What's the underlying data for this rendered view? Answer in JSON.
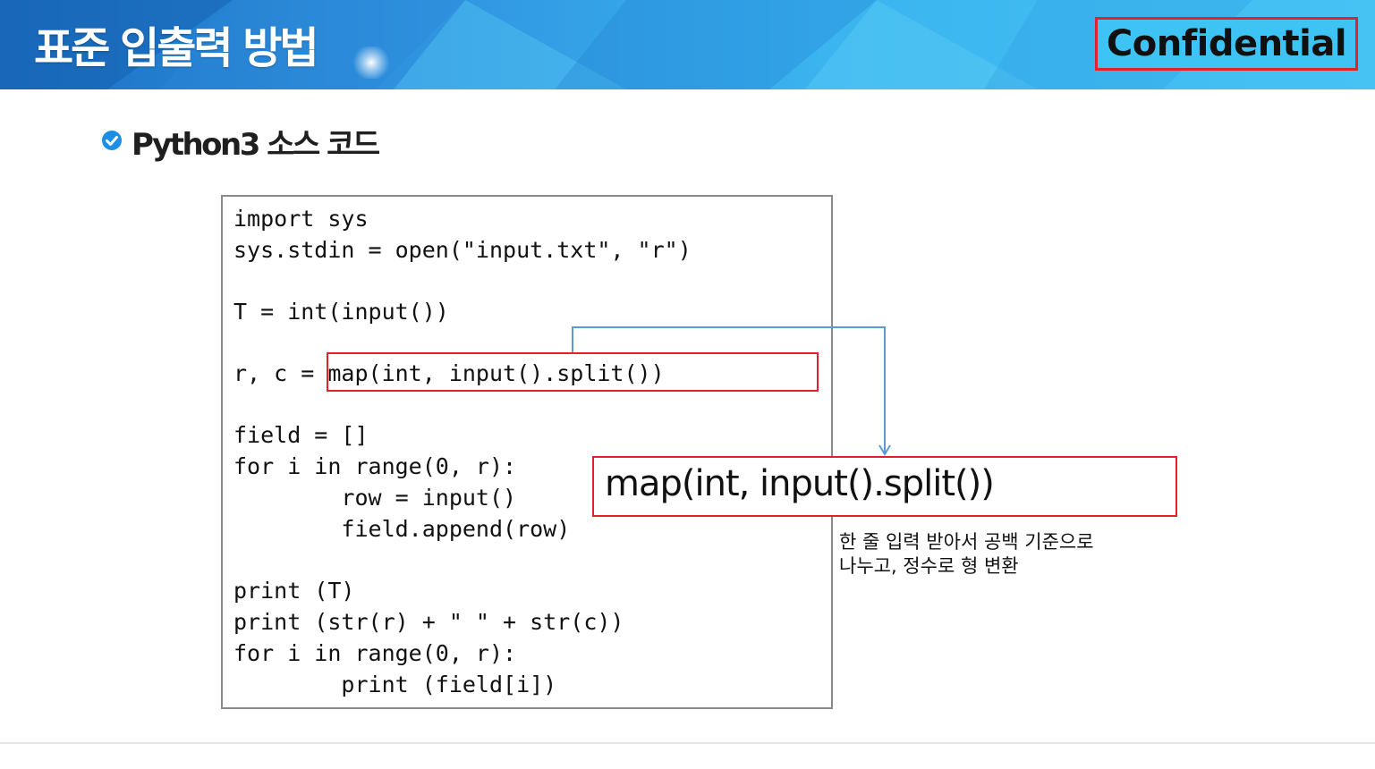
{
  "header": {
    "title": "표준 입출력 방법",
    "confidential_label": "Confidential"
  },
  "section": {
    "bullet_icon": "check-circle-icon",
    "title": "Python3 소스 코드"
  },
  "code": {
    "lines": [
      "import sys",
      "sys.stdin = open(\"input.txt\", \"r\")",
      "T = int(input())",
      "r, c = map(int, input().split())",
      "field = []",
      "for i in range(0, r):",
      "        row = input()",
      "        field.append(row)",
      "print (T)",
      "print (str(r) + \" \" + str(c))",
      "for i in range(0, r):",
      "        print (field[i])"
    ]
  },
  "callout": {
    "expression": "map(int, input().split())",
    "description_lines": [
      "한 줄 입력 받아서 공백 기준으로",
      "나누고, 정수로 형 변환"
    ]
  },
  "colors": {
    "highlight_border": "#e0232b",
    "connector": "#5b9bd5",
    "header_gradient_start": "#1b6fc2",
    "header_gradient_end": "#46c3f3"
  }
}
